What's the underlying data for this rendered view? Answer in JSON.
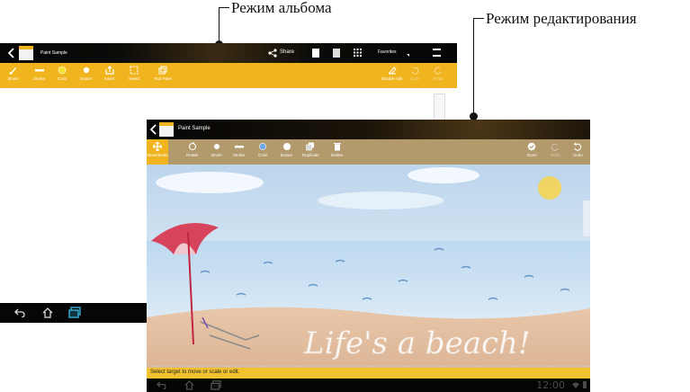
{
  "callouts": {
    "album_label": "Режим альбома",
    "edit_label": "Режим редактирования"
  },
  "album": {
    "title": "Paint Sample",
    "actions": {
      "share": "Share",
      "favorites": "Favorites"
    },
    "toolbar": [
      {
        "icon": "brush-icon",
        "label": "Brush"
      },
      {
        "icon": "stroke-icon",
        "label": "Stroke"
      },
      {
        "icon": "color-icon",
        "label": "Color"
      },
      {
        "icon": "eraser-icon",
        "label": "Eraser"
      },
      {
        "icon": "insert-icon",
        "label": "Insert"
      },
      {
        "icon": "select-icon",
        "label": "Select"
      },
      {
        "icon": "tool-pane-icon",
        "label": "Tool Pane"
      }
    ],
    "right_actions": [
      {
        "icon": "disable-edit-icon",
        "label": "Disable edit"
      },
      {
        "icon": "undo-icon",
        "label": "Undo"
      },
      {
        "icon": "redo-icon",
        "label": "Redo"
      }
    ],
    "accent": "#f0b41e"
  },
  "edit": {
    "title": "Paint Sample",
    "toolbar": [
      {
        "icon": "move-scale-icon",
        "label": "Move/Scale"
      },
      {
        "icon": "rotate-icon",
        "label": "Rotate"
      },
      {
        "icon": "brush-icon",
        "label": "Brush"
      },
      {
        "icon": "stroke-icon",
        "label": "Stroke"
      },
      {
        "icon": "color-icon",
        "label": "Color"
      },
      {
        "icon": "eraser-icon",
        "label": "Eraser"
      },
      {
        "icon": "duplicate-icon",
        "label": "Duplicate"
      },
      {
        "icon": "delete-icon",
        "label": "Delete"
      }
    ],
    "right_actions": [
      {
        "icon": "done-icon",
        "label": "Done"
      },
      {
        "icon": "redo-icon",
        "label": "Redo"
      },
      {
        "icon": "undo-icon",
        "label": "Undo"
      }
    ],
    "status_text": "Select target to move or scale or edit.",
    "clock": "12:00",
    "canvas_text": "Life's a beach!",
    "accent": "#f0c22e"
  }
}
